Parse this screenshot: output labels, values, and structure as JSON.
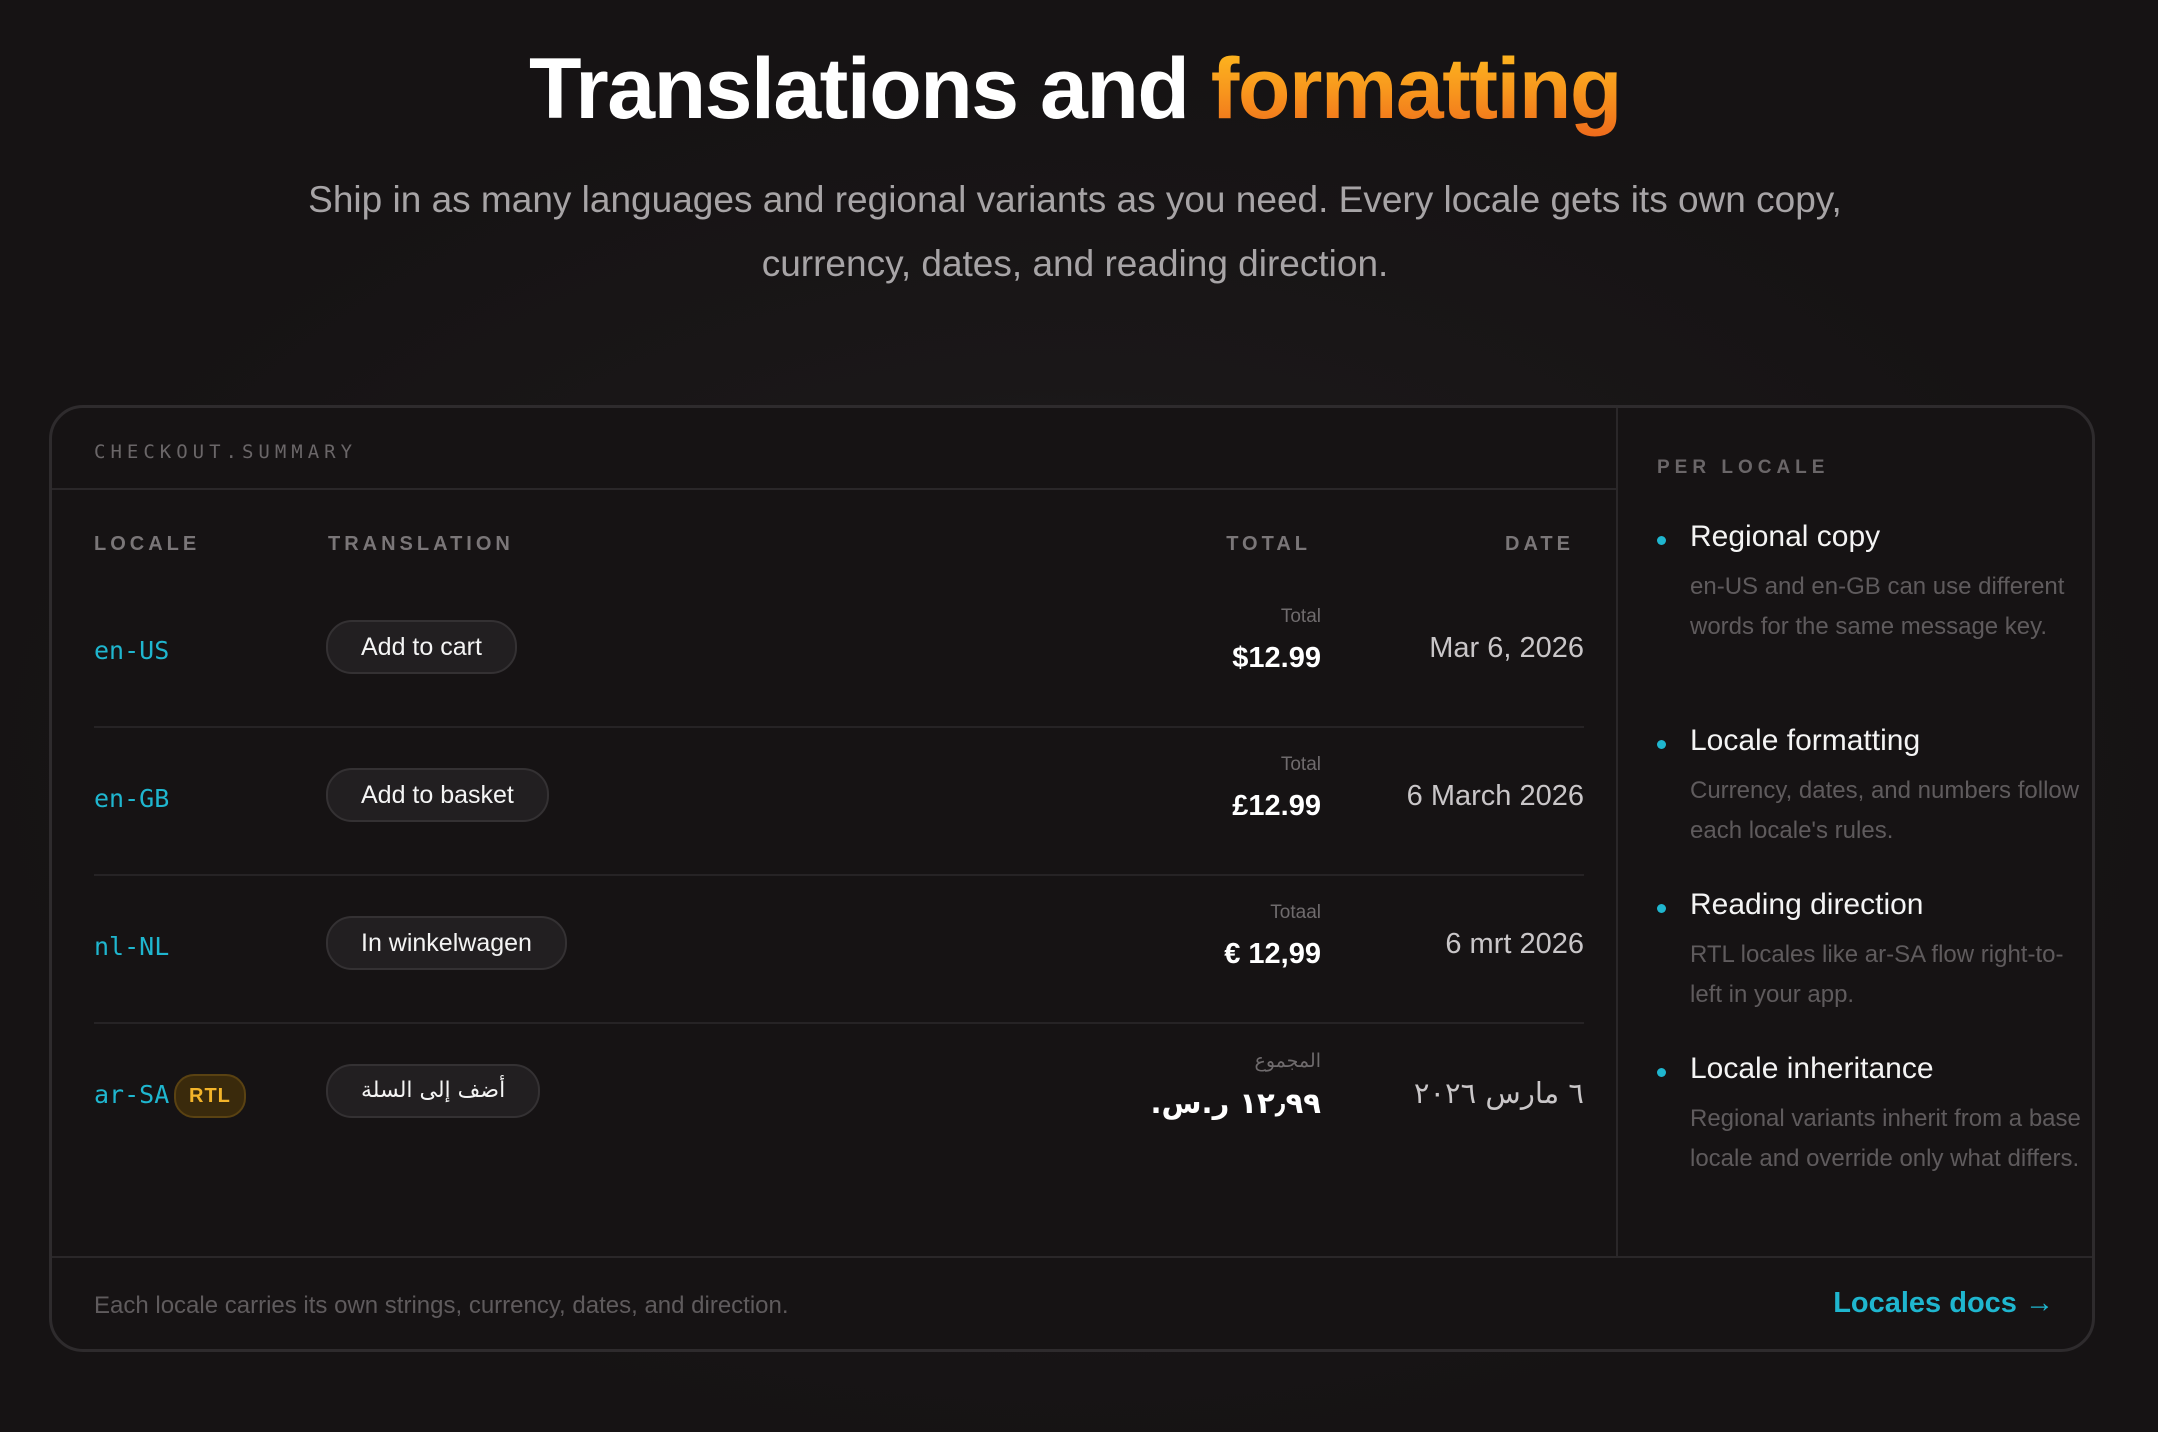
{
  "hero": {
    "title_main": "Translations and ",
    "title_accent": "formatting",
    "subtitle": "Ship in as many languages and regional variants as you need. Every locale gets its own copy, currency, dates, and reading direction."
  },
  "card": {
    "key_label": "CHECKOUT.SUMMARY",
    "columns": {
      "locale": "LOCALE",
      "translation": "TRANSLATION",
      "total": "TOTAL",
      "date": "DATE"
    },
    "rows": [
      {
        "locale": "en-US",
        "badge": "",
        "translation": "Add to cart",
        "total_label": "Total",
        "total": "$12.99",
        "date": "Mar 6, 2026"
      },
      {
        "locale": "en-GB",
        "badge": "",
        "translation": "Add to basket",
        "total_label": "Total",
        "total": "£12.99",
        "date": "6 March 2026"
      },
      {
        "locale": "nl-NL",
        "badge": "",
        "translation": "In winkelwagen",
        "total_label": "Totaal",
        "total": "€ 12,99",
        "date": "6 mrt 2026"
      },
      {
        "locale": "ar-SA",
        "badge": "RTL",
        "translation": "أضف إلى السلة",
        "total_label": "المجموع",
        "total": "١٢٫٩٩ ر.س.",
        "date": "٦ مارس ٢٠٢٦"
      }
    ],
    "footer_text": "Each locale carries its own strings, currency, dates, and direction.",
    "docs_link": "Locales docs →"
  },
  "side": {
    "label": "PER LOCALE",
    "features": [
      {
        "title": "Regional copy",
        "desc": "en-US and en-GB can use different words for the same message key."
      },
      {
        "title": "Locale formatting",
        "desc": "Currency, dates, and numbers follow each locale's rules."
      },
      {
        "title": "Reading direction",
        "desc": "RTL locales like ar-SA flow right-to-left in your app."
      },
      {
        "title": "Locale inheritance",
        "desc": "Regional variants inherit from a base locale and override only what differs."
      }
    ]
  },
  "colors": {
    "accent": "#1fb6cf",
    "title_gradient_top": "#ffbe1f",
    "title_gradient_bottom": "#ee6a1c",
    "rtl_badge": "#f3b42a",
    "background": "#161314"
  }
}
